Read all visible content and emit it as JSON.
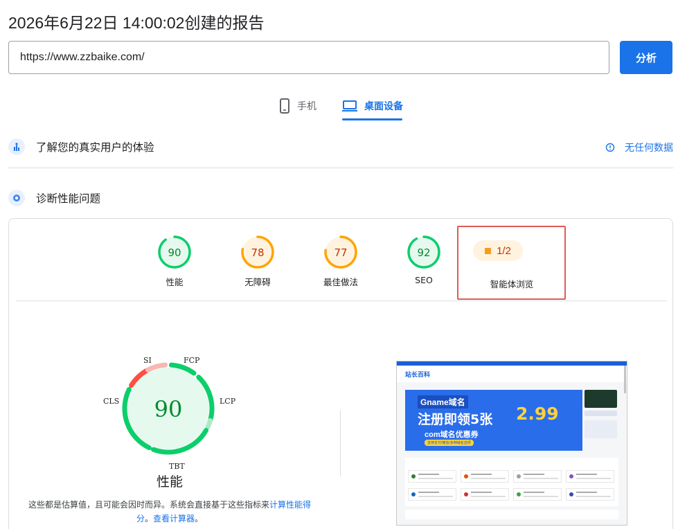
{
  "report_title": "2026年6月22日 14:00:02创建的报告",
  "url_input": {
    "value": "https://www.zzbaike.com/"
  },
  "analyze_label": "分析",
  "tabs": [
    {
      "label": "手机",
      "icon": "phone-icon",
      "active": false
    },
    {
      "label": "桌面设备",
      "icon": "laptop-icon",
      "active": true
    }
  ],
  "real_user_section": {
    "title": "了解您的真实用户的体验",
    "icon": "users-chart-icon",
    "no_data_label": "无任何数据",
    "no_data_icon": "info-icon"
  },
  "diagnose_section": {
    "title": "诊断性能问题",
    "icon": "lighthouse-icon"
  },
  "scores": [
    {
      "label": "性能",
      "score": "90",
      "color": "#0cce6b",
      "bg": "#e6f9ee",
      "text_color": "#008a2e"
    },
    {
      "label": "无障碍",
      "score": "78",
      "color": "#ffa400",
      "bg": "#fff3e0",
      "text_color": "#c33300"
    },
    {
      "label": "最佳做法",
      "score": "77",
      "color": "#ffa400",
      "bg": "#fff3e0",
      "text_color": "#c33300"
    },
    {
      "label": "SEO",
      "score": "92",
      "color": "#0cce6b",
      "bg": "#e6f9ee",
      "text_color": "#008a2e"
    }
  ],
  "agent_browsing": {
    "label": "智能体浏览",
    "value": "1/2",
    "color": "#fa9a1d"
  },
  "performance_gauge": {
    "score": "90",
    "title": "性能",
    "metrics": [
      "SI",
      "FCP",
      "LCP",
      "TBT",
      "CLS"
    ],
    "colors": {
      "good": "#0cce6b",
      "poor": "#ff4e42",
      "poor_light": "#f9b6b3",
      "good_light": "#aee8c5"
    }
  },
  "estimate_note": {
    "text": "这些都是估算值，且可能会因时而异。系统会直接基于这些指标来",
    "link1": "计算性能得分",
    "sep": "。",
    "link2": "查看计算器",
    "end": "。"
  },
  "screenshot": {
    "logo": "站长百科",
    "banner_line1": "Gname域名",
    "banner_line2": "注册即领5张",
    "banner_price": "2.99",
    "banner_line3": "com域名优惠券",
    "banner_button": "支持支付/微信/多种域名选项"
  }
}
